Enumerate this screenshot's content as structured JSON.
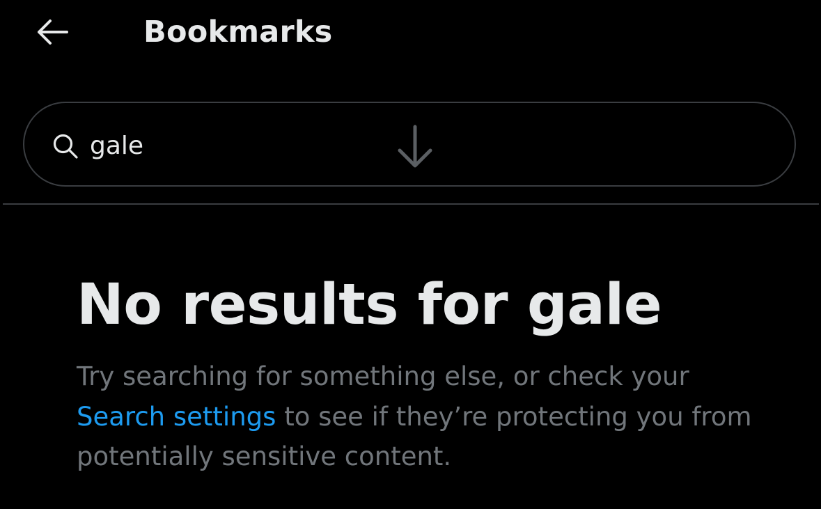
{
  "header": {
    "back_icon": "arrow-left-icon",
    "title": "Bookmarks"
  },
  "search": {
    "icon": "search-icon",
    "value": "gale",
    "refresh_icon": "arrow-down-icon"
  },
  "empty_state": {
    "title": "No results for gale",
    "body_prefix": "Try searching for something else, or check your ",
    "link_text": "Search settings",
    "body_suffix": " to see if they’re protecting you from potentially sensitive content."
  },
  "colors": {
    "background": "#000000",
    "primary_text": "#e7e9ea",
    "secondary_text": "#71767b",
    "link": "#1d9bf0",
    "border": "#3a3d41"
  }
}
